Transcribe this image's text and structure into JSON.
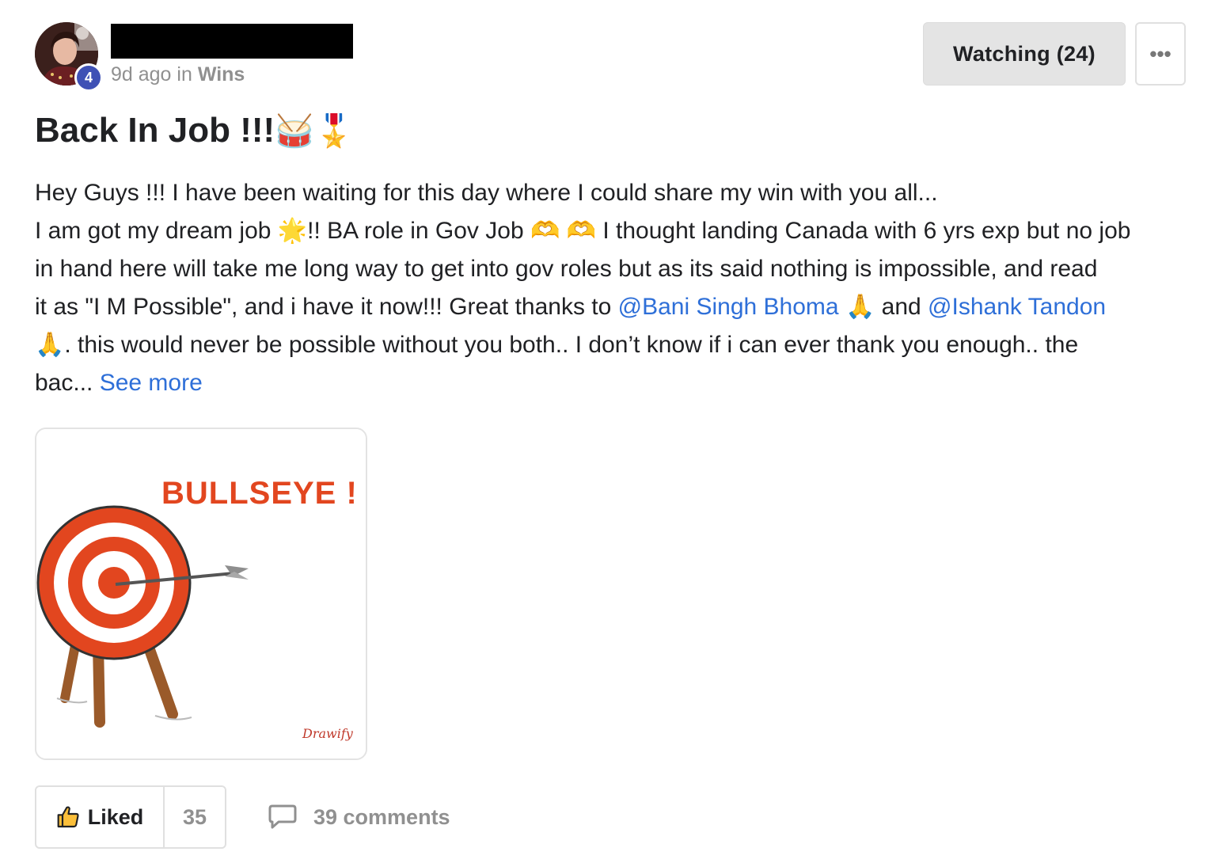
{
  "post": {
    "level": "4",
    "time_ago": "9d ago",
    "in_label": "in",
    "category": "Wins",
    "watch_label": "Watching (24)",
    "more_icon": "•••",
    "title": "Back In Job !!!",
    "title_emojis": "🥁🎖️",
    "body": {
      "line1": "Hey Guys !!! I have been waiting for this day where I could share my win with you all...",
      "line2_a": "I am got my dream job ",
      "line2_emoji1": "🌟",
      "line2_b": "!! BA role in Gov Job ",
      "line2_emoji2": "🫶 🫶",
      "line2_c": " I thought landing Canada with 6 yrs exp but no job",
      "line3": "in hand here will take me long way to get into gov roles but as its said nothing is impossible, and read",
      "line4_a": "it as \"I M Possible\", and i have it now!!! Great thanks to ",
      "mention1": "@Bani Singh Bhoma",
      "pray_emoji": "🙏",
      "line4_b": " and ",
      "mention2": "@Ishank Tandon",
      "line5": ". this would never be possible without you both.. I don’t know if i can ever thank you enough.. the",
      "line6": "bac... ",
      "see_more": "See more"
    },
    "image": {
      "caption": "BULLSEYE !",
      "signature": "Drawify"
    },
    "like_label": "Liked",
    "like_count": "35",
    "comments_label": "39 comments"
  },
  "colors": {
    "accent_link": "#2e6fd8",
    "badge": "#3f51b5",
    "muted": "#909090",
    "target_red": "#e2461f"
  },
  "icons": [
    "level-badge",
    "more-dots-icon",
    "thumbs-up-icon",
    "comment-bubble-icon"
  ]
}
